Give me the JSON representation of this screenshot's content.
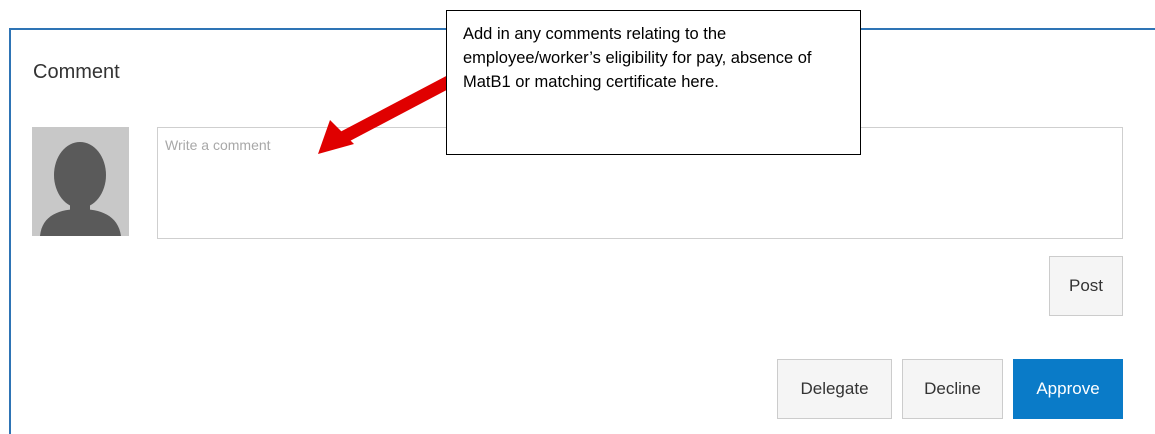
{
  "comment": {
    "title": "Comment",
    "placeholder": "Write a comment"
  },
  "buttons": {
    "post": "Post",
    "delegate": "Delegate",
    "decline": "Decline",
    "approve": "Approve"
  },
  "callout": {
    "text": "Add in any comments relating to the employee/worker’s eligibility for pay, absence of MatB1 or matching certificate here."
  },
  "colors": {
    "frame_border": "#2e74b5",
    "approve": "#0a7bc8",
    "arrow": "#e00000"
  }
}
